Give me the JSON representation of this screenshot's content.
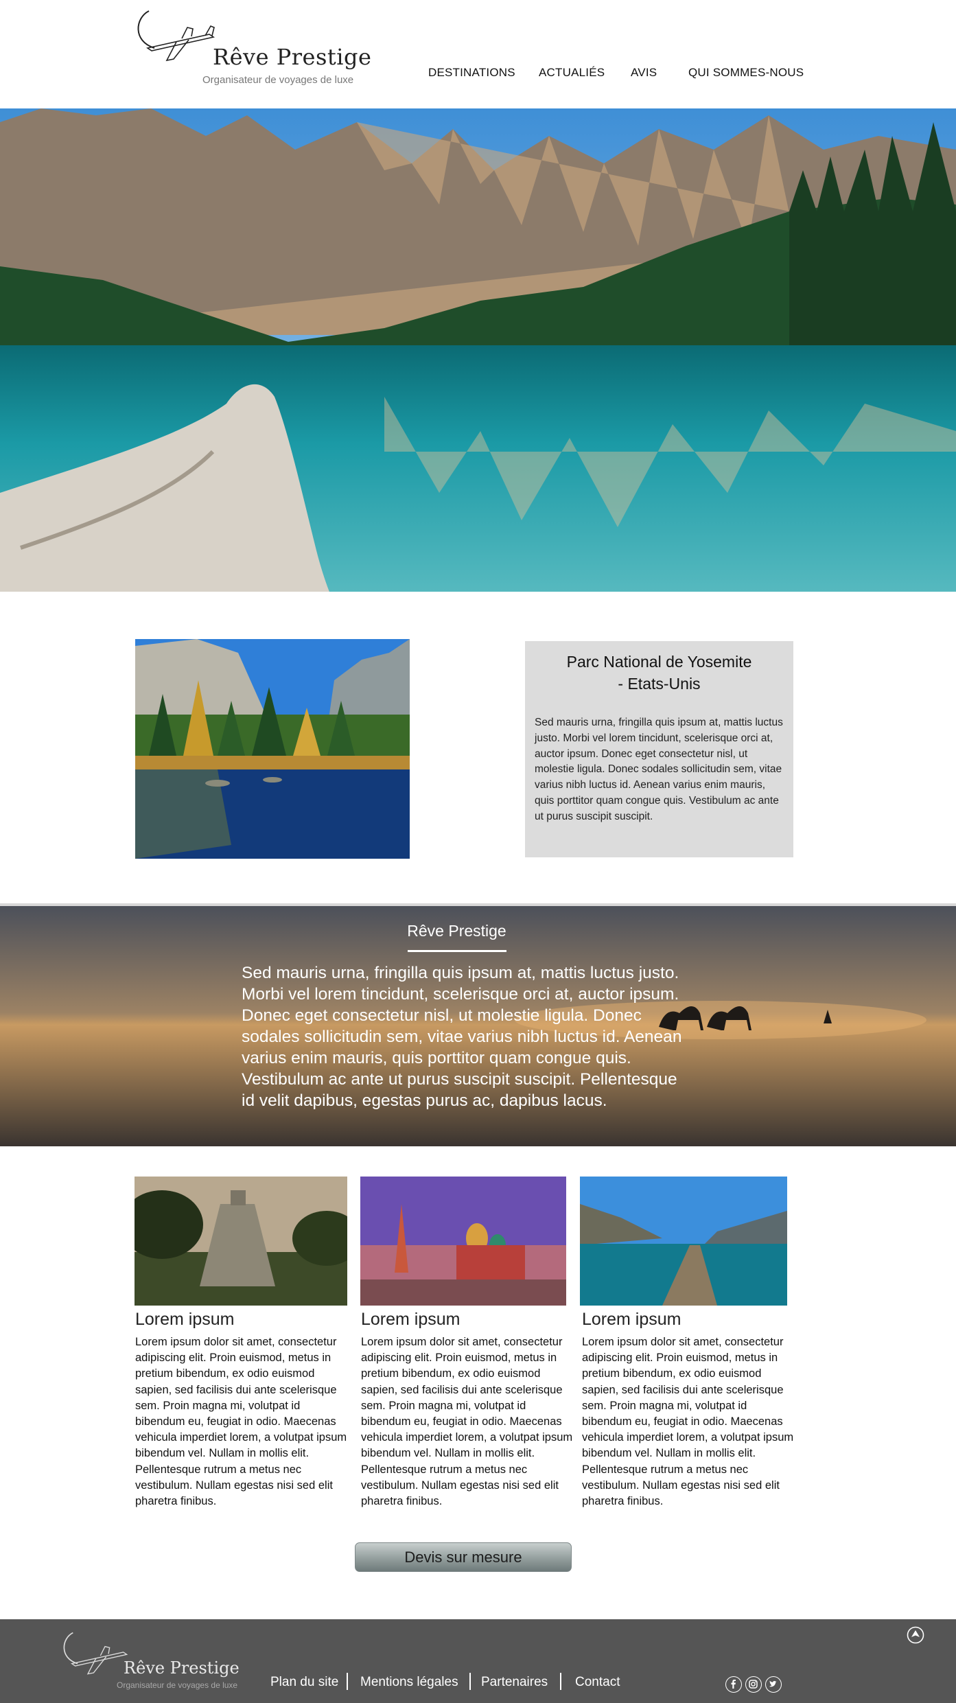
{
  "brand": {
    "name": "Rêve Prestige",
    "tagline": "Organisateur de voyages de luxe"
  },
  "nav": {
    "items": [
      "DESTINATIONS",
      "ACTUALIÉS",
      "AVIS",
      "QUI SOMMES-NOUS"
    ]
  },
  "hero": {
    "image": "mountain-lake-photo"
  },
  "feature": {
    "image": "yosemite-photo",
    "title_line1": "Parc National de Yosemite",
    "title_line2": "- Etats-Unis",
    "text": "Sed mauris urna, fringilla quis ipsum at, mattis luctus justo. Morbi vel lorem tincidunt, scelerisque orci at, auctor ipsum. Donec eget consectetur nisl, ut molestie ligula. Donec sodales sollicitudin sem, vitae varius nibh luctus id. Aenean varius enim mauris, quis porttitor quam congue quis. Vestibulum ac ante ut purus suscipit suscipit."
  },
  "banner": {
    "image": "desert-camels-sunset-photo",
    "title": "Rêve Prestige",
    "text": "Sed mauris urna, fringilla quis ipsum at, mattis luctus justo. Morbi vel lorem tincidunt, scelerisque orci at, auctor ipsum. Donec eget consectetur nisl, ut molestie ligula. Donec sodales sollicitudin sem, vitae varius nibh luctus id. Aenean varius enim mauris, quis porttitor quam congue quis. Vestibulum ac ante ut purus suscipit suscipit. Pellentesque id velit dapibus, egestas purus ac, dapibus lacus."
  },
  "cards": [
    {
      "image": "mayan-temple-photo",
      "title": "Lorem ipsum",
      "text": "Lorem ipsum dolor sit amet, consectetur adipiscing elit. Proin euismod, metus in pretium bibendum, ex odio euismod sapien, sed facilisis dui ante scelerisque sem. Proin magna mi, volutpat id bibendum eu, feugiat in odio. Maecenas vehicula imperdiet lorem, a volutpat ipsum bibendum vel. Nullam in mollis elit. Pellentesque rutrum a metus nec vestibulum. Nullam egestas nisi sed elit pharetra finibus."
    },
    {
      "image": "moscow-red-square-photo",
      "title": "Lorem ipsum",
      "text": "Lorem ipsum dolor sit amet, consectetur adipiscing elit. Proin euismod, metus in pretium bibendum, ex odio euismod sapien, sed facilisis dui ante scelerisque sem. Proin magna mi, volutpat id bibendum eu, feugiat in odio. Maecenas vehicula imperdiet lorem, a volutpat ipsum bibendum vel. Nullam in mollis elit. Pellentesque rutrum a metus nec vestibulum. Nullam egestas nisi sed elit pharetra finibus."
    },
    {
      "image": "lake-pier-photo",
      "title": "Lorem ipsum",
      "text": "Lorem ipsum dolor sit amet, consectetur adipiscing elit. Proin euismod, metus in pretium bibendum, ex odio euismod sapien, sed facilisis dui ante scelerisque sem. Proin magna mi, volutpat id bibendum eu, feugiat in odio. Maecenas vehicula imperdiet lorem, a volutpat ipsum bibendum vel. Nullam in mollis elit. Pellentesque rutrum a metus nec vestibulum. Nullam egestas nisi sed elit pharetra finibus."
    }
  ],
  "cta": {
    "label": "Devis sur mesure"
  },
  "footer": {
    "links": [
      "Plan du site",
      "Mentions légales",
      "Partenaires",
      "Contact"
    ],
    "social": [
      "facebook-icon",
      "instagram-icon",
      "twitter-icon"
    ],
    "back_to_top": "arrow-up-icon"
  },
  "colors": {
    "footer_bg": "#555555",
    "feature_box_bg": "#dcdcdc",
    "cta_top": "#c8cfce",
    "cta_bottom": "#6e7a7a"
  }
}
